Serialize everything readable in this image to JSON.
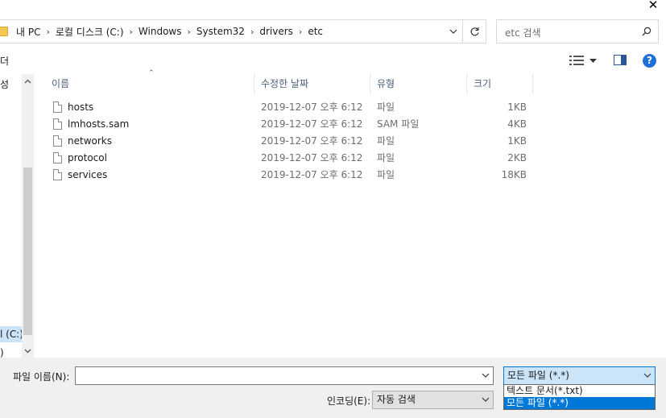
{
  "window": {
    "close_glyph": "✕"
  },
  "address_bar": {
    "crumbs": [
      "내 PC",
      "로컬 디스크 (C:)",
      "Windows",
      "System32",
      "drivers",
      "etc"
    ],
    "separator": "›"
  },
  "search": {
    "placeholder": "etc 검색"
  },
  "toolbar": {
    "left_label": "더"
  },
  "nav_pane": {
    "item_top": "성",
    "drive_label": "l (C:)",
    "item_bottom": ")"
  },
  "columns": {
    "name": "이름",
    "date": "수정한 날짜",
    "type": "유형",
    "size": "크기"
  },
  "files": [
    {
      "name": "hosts",
      "date": "2019-12-07 오후 6:12",
      "type": "파일",
      "size": "1KB"
    },
    {
      "name": "lmhosts.sam",
      "date": "2019-12-07 오후 6:12",
      "type": "SAM 파일",
      "size": "4KB"
    },
    {
      "name": "networks",
      "date": "2019-12-07 오후 6:12",
      "type": "파일",
      "size": "1KB"
    },
    {
      "name": "protocol",
      "date": "2019-12-07 오후 6:12",
      "type": "파일",
      "size": "2KB"
    },
    {
      "name": "services",
      "date": "2019-12-07 오후 6:12",
      "type": "파일",
      "size": "18KB"
    }
  ],
  "bottom": {
    "filename_label": "파일 이름(N):",
    "filename_value": "",
    "filetype_selected": "모든 파일 (*.*)",
    "filetype_options": [
      "텍스트 문서(*.txt)",
      "모든 파일 (*.*)"
    ],
    "encoding_label": "인코딩(E):",
    "encoding_value": "자동 검색"
  },
  "colors": {
    "accent": "#0078d7",
    "selection": "#cce4f7"
  }
}
